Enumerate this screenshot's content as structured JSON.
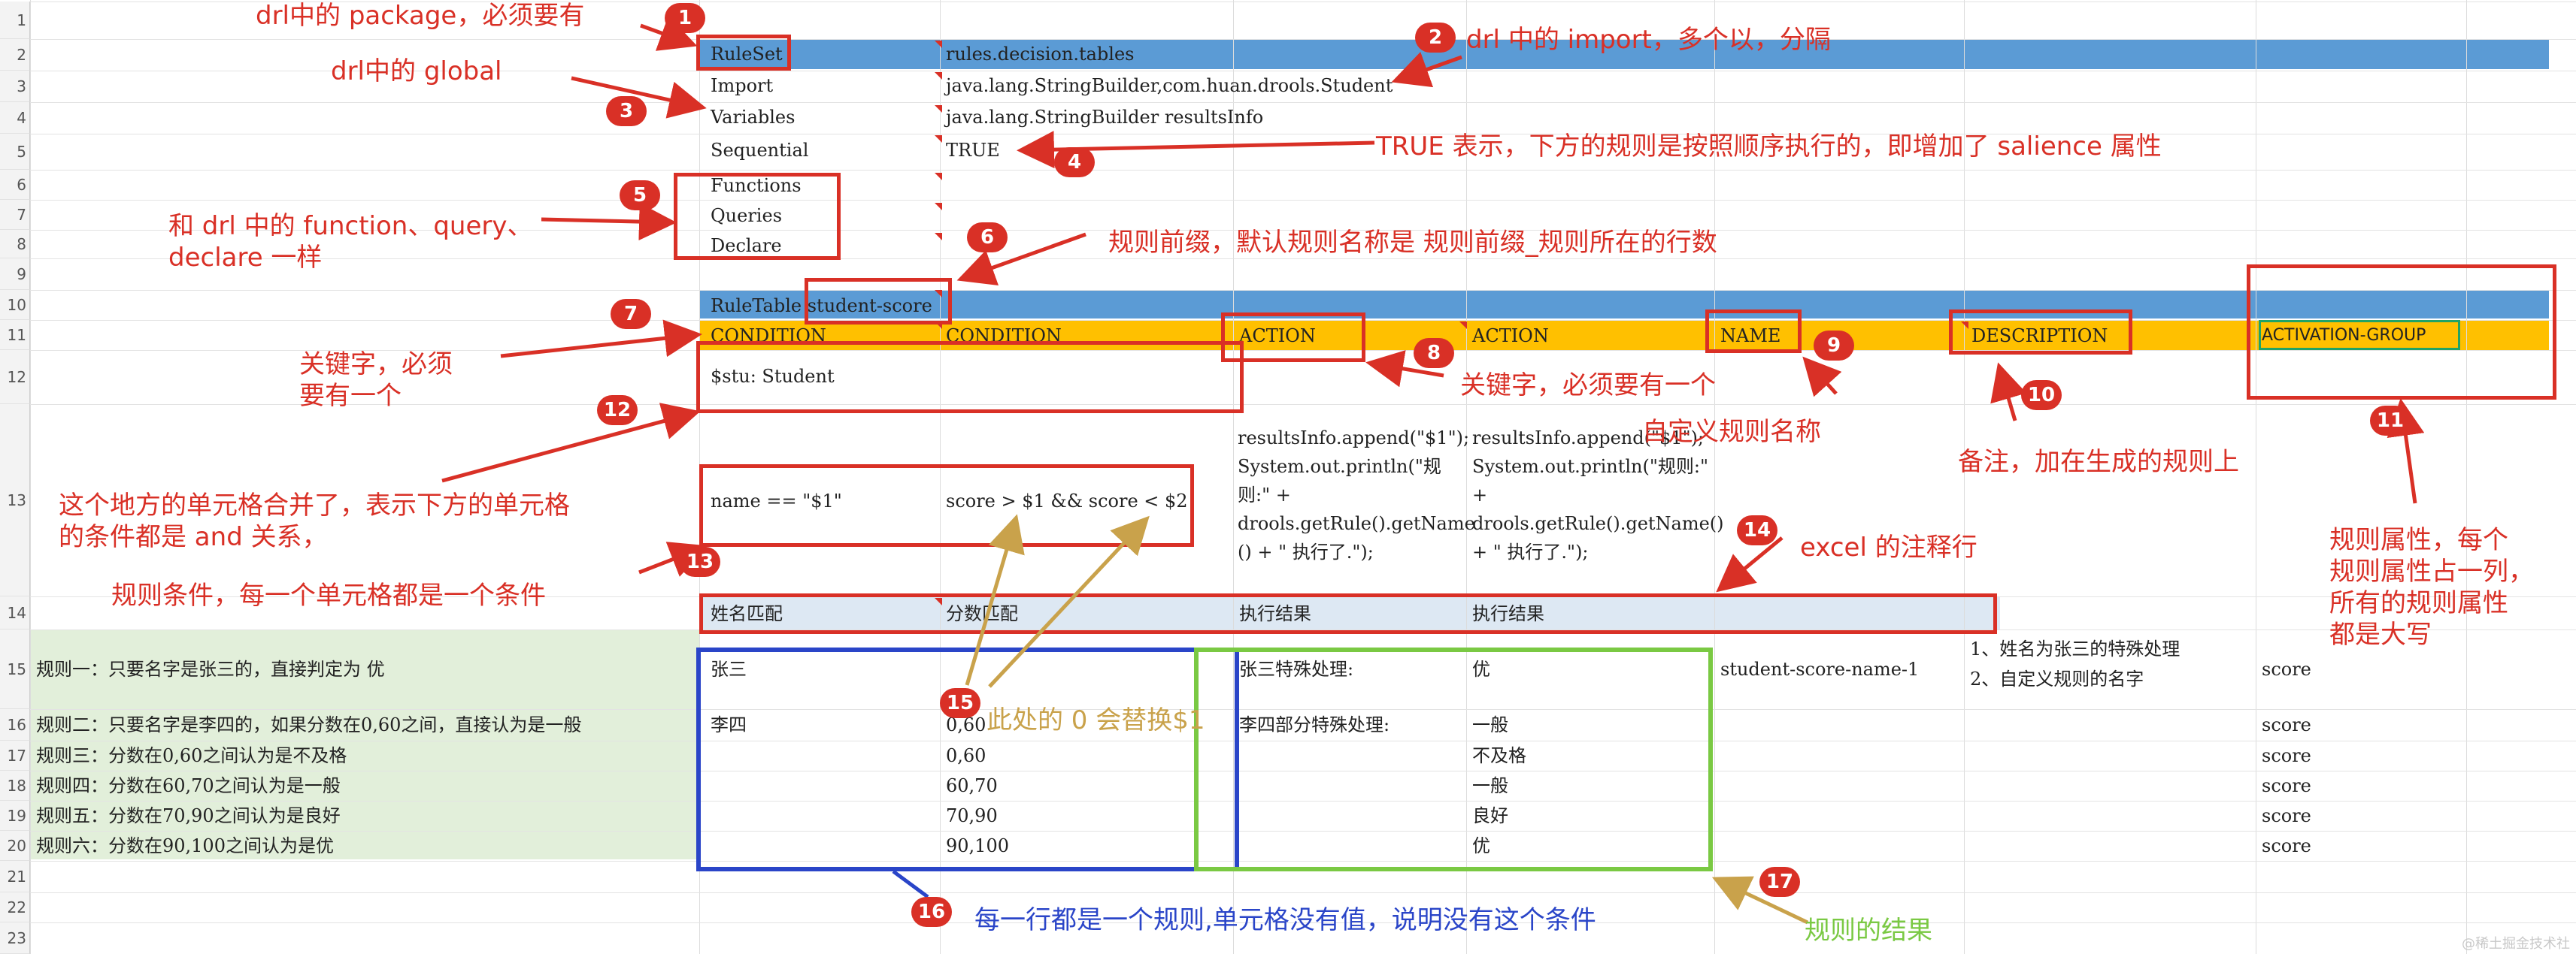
{
  "row_numbers": [
    "1",
    "2",
    "3",
    "4",
    "5",
    "6",
    "7",
    "8",
    "9",
    "10",
    "11",
    "12",
    "13",
    "14",
    "15",
    "16",
    "17",
    "18",
    "19",
    "20",
    "21",
    "22",
    "23"
  ],
  "cells": {
    "ruleset_key": "RuleSet",
    "ruleset_val": "rules.decision.tables",
    "import_key": "Import",
    "import_val": "java.lang.StringBuilder,com.huan.drools.Student",
    "variables_key": "Variables",
    "variables_val": "java.lang.StringBuilder resultsInfo",
    "sequential_key": "Sequential",
    "sequential_val": "TRUE",
    "functions_key": "Functions",
    "queries_key": "Queries",
    "declare_key": "Declare",
    "ruletable": "RuleTable student-score",
    "h_condition1": "CONDITION",
    "h_condition2": "CONDITION",
    "h_action1": "ACTION",
    "h_action2": "ACTION",
    "h_name": "NAME",
    "h_description": "DESCRIPTION",
    "h_activation": "ACTIVATION-GROUP",
    "object_type": "$stu: Student",
    "cond_name": "name == \"$1\"",
    "cond_score": "score > $1 && score < $2",
    "action1_code": "resultsInfo.append(\"$1\");\nSystem.out.println(\"规\n则:\" +\ndrools.getRule().getName\n() + \" 执行了.\");",
    "action2_code": "resultsInfo.append(\"$1\");\nSystem.out.println(\"规则:\"\n+\ndrools.getRule().getName()\n+ \" 执行了.\");",
    "comment_1": "姓名匹配",
    "comment_2": "分数匹配",
    "comment_3": "执行结果",
    "comment_4": "执行结果"
  },
  "rules": [
    {
      "desc": "规则一：只要名字是张三的，直接判定为 优",
      "name": "张三",
      "score": "",
      "act1": "张三特殊处理:",
      "act2": "优",
      "rname": "student-score-name-1",
      "rdesc": "1、姓名为张三的特殊处理\n2、自定义规则的名字",
      "group": "score"
    },
    {
      "desc": "规则二：只要名字是李四的，如果分数在0,60之间，直接认为是一般",
      "name": "李四",
      "score": "0,60",
      "act1": "李四部分特殊处理:",
      "act2": "一般",
      "rname": "",
      "rdesc": "",
      "group": "score"
    },
    {
      "desc": "规则三：分数在0,60之间认为是不及格",
      "name": "",
      "score": "0,60",
      "act1": "",
      "act2": "不及格",
      "rname": "",
      "rdesc": "",
      "group": "score"
    },
    {
      "desc": "规则四：分数在60,70之间认为是一般",
      "name": "",
      "score": "60,70",
      "act1": "",
      "act2": "一般",
      "rname": "",
      "rdesc": "",
      "group": "score"
    },
    {
      "desc": "规则五：分数在70,90之间认为是良好",
      "name": "",
      "score": "70,90",
      "act1": "",
      "act2": "良好",
      "rname": "",
      "rdesc": "",
      "group": "score"
    },
    {
      "desc": "规则六：分数在90,100之间认为是优",
      "name": "",
      "score": "90,100",
      "act1": "",
      "act2": "优",
      "rname": "",
      "rdesc": "",
      "group": "score"
    }
  ],
  "annotations": {
    "a1": "drl中的 package，必须要有",
    "a2": "drl 中的 import，多个以，分隔",
    "a3": "drl中的 global",
    "a4": "TRUE 表示，下方的规则是按照顺序执行的，即增加了 salience 属性",
    "a5": "和 drl 中的 function、query、\ndeclare 一样",
    "a6": "规则前缀，默认规则名称是 规则前缀_规则所在的行数",
    "a7": "关键字，必须\n要有一个",
    "a8": "关键字，必须要有一个",
    "a9": "自定义规则名称",
    "a10": "备注，加在生成的规则上",
    "a11": "规则属性，每个\n规则属性占一列，\n所有的规则属性\n都是大写",
    "a12": "这个地方的单元格合并了，表示下方的单元格\n的条件都是 and 关系，",
    "a13": "规则条件，每一个单元格都是一个条件",
    "a14": "excel 的注释行",
    "a15": "此处的 0 会替换$1",
    "a16": "每一行都是一个规则,单元格没有值，说明没有这个条件",
    "a17": "规则的结果"
  },
  "badges": [
    "1",
    "2",
    "3",
    "4",
    "5",
    "6",
    "7",
    "8",
    "9",
    "10",
    "11",
    "12",
    "13",
    "14",
    "15",
    "16",
    "17"
  ],
  "watermark": "@稀土掘金技术社区",
  "colors": {
    "header_blue": "#5b9bd5",
    "header_orange": "#ffc000",
    "comment_row": "#dde8f3",
    "rule_desc_bg": "#e2efda",
    "annotation_red": "#d93026",
    "annotation_blue": "#2a45c8",
    "annotation_green": "#7ac943",
    "annotation_gold": "#c9a24b"
  }
}
